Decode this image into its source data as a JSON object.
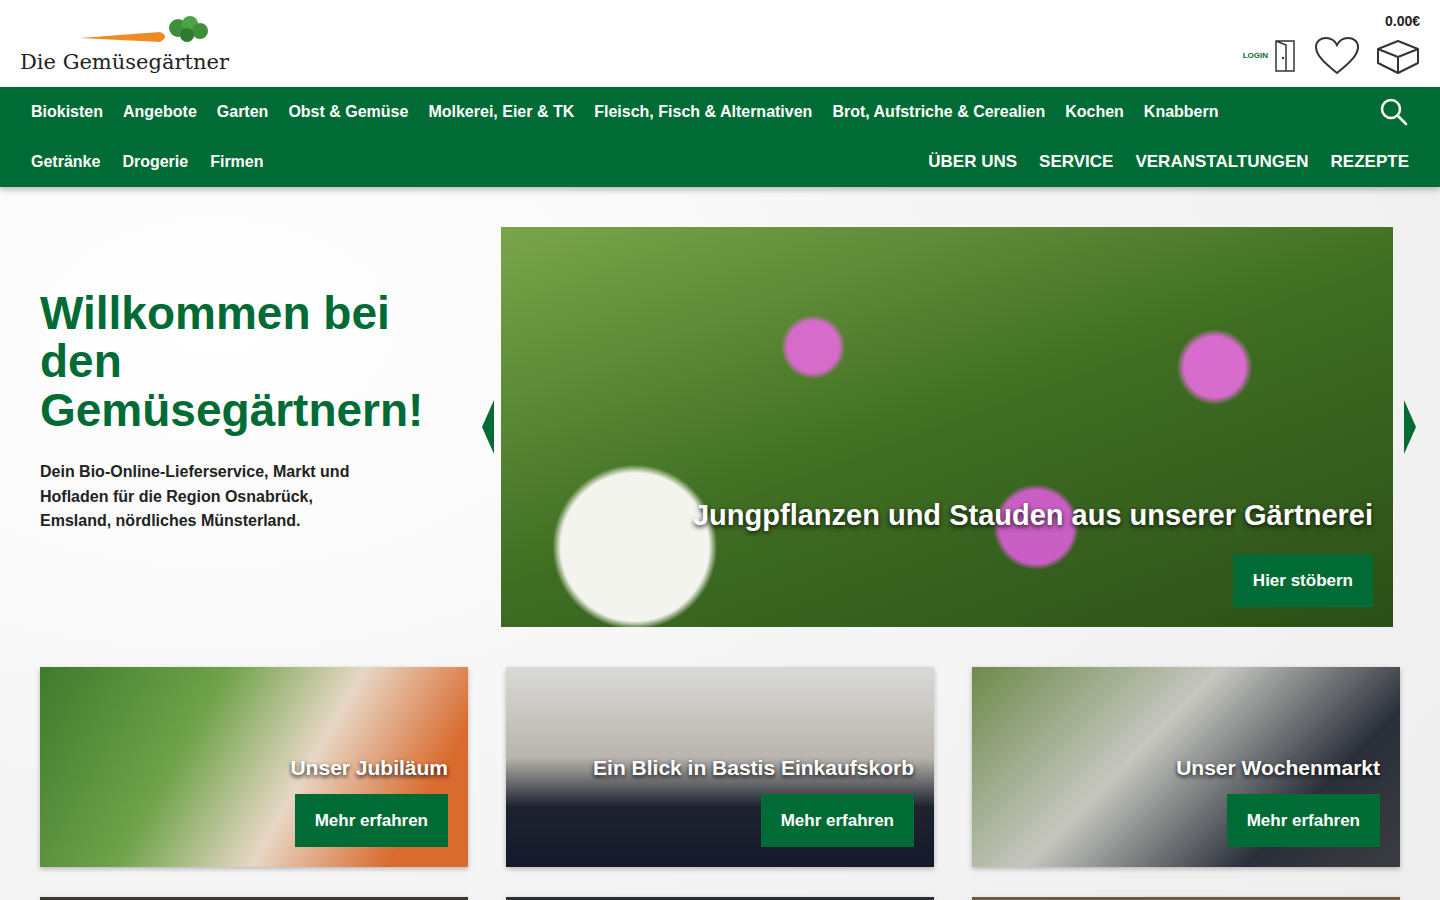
{
  "header": {
    "logo_text": "Die Gemüsegärtner",
    "login_label": "LOGIN",
    "cart_total": "0.00€"
  },
  "nav": {
    "main": [
      "Biokisten",
      "Angebote",
      "Garten",
      "Obst & Gemüse",
      "Molkerei, Eier & TK",
      "Fleisch, Fisch & Alternativen",
      "Brot, Aufstriche & Cerealien",
      "Kochen",
      "Knabbern"
    ],
    "secondary": [
      "Getränke",
      "Drogerie",
      "Firmen"
    ],
    "info": [
      "ÜBER UNS",
      "SERVICE",
      "VERANSTALTUNGEN",
      "REZEPTE"
    ]
  },
  "hero": {
    "title": "Willkommen bei den Gemüsegärtnern!",
    "subtitle": "Dein Bio-Online-Lieferservice, Markt und Hofladen für die Region Osnabrück, Emsland, nördliches Münsterland.",
    "slide": {
      "caption": "Jungpflanzen und Stauden aus unserer Gärtnerei",
      "button": "Hier stöbern"
    }
  },
  "teasers": [
    {
      "title": "Unser Jubiläum",
      "button": "Mehr erfahren"
    },
    {
      "title": "Ein Blick in Bastis Einkaufskorb",
      "button": "Mehr erfahren"
    },
    {
      "title": "Unser Wochenmarkt",
      "button": "Mehr erfahren"
    }
  ]
}
